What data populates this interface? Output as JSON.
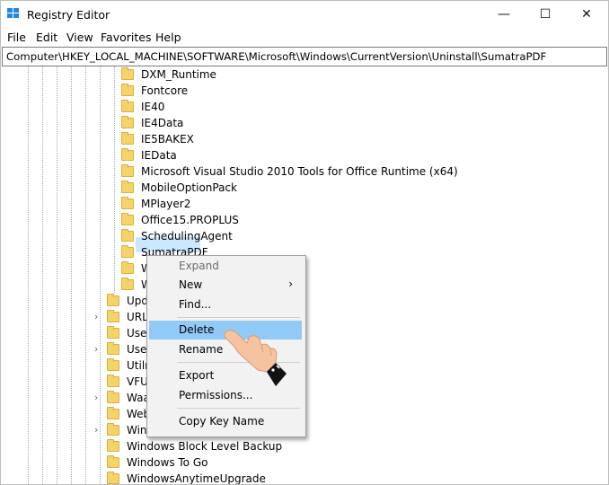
{
  "window": {
    "title": "Registry Editor",
    "controls": {
      "minimize": "—",
      "maximize": "☐",
      "close": "✕"
    }
  },
  "menu": [
    "File",
    "Edit",
    "View",
    "Favorites",
    "Help"
  ],
  "address": "Computer\\HKEY_LOCAL_MACHINE\\SOFTWARE\\Microsoft\\Windows\\CurrentVersion\\Uninstall\\SumatraPDF",
  "tree": {
    "subkeys": [
      "DXM_Runtime",
      "Fontcore",
      "IE40",
      "IE4Data",
      "IE5BAKEX",
      "IEData",
      "Microsoft Visual Studio 2010 Tools for Office Runtime (x64)",
      "MobileOptionPack",
      "MPlayer2",
      "Office15.PROPLUS",
      "SchedulingAgent",
      "SumatraPDF",
      "W",
      "W"
    ],
    "parent_keys": [
      "Upda",
      "URL",
      "User",
      "User",
      "Utiln",
      "VFUF",
      "Waa",
      "Web",
      "WinE",
      "Windows Block Level Backup",
      "Windows To Go",
      "WindowsAnytimeUpgrade"
    ]
  },
  "context_menu": {
    "expand": "Expand",
    "new": "New",
    "find": "Find...",
    "delete": "Delete",
    "rename": "Rename",
    "export": "Export",
    "permissions": "Permissions...",
    "copy_key_name": "Copy Key Name"
  },
  "colors": {
    "selection": "#cce8ff",
    "menu_hover": "#91c9f7",
    "folder": "#f6d36a"
  }
}
